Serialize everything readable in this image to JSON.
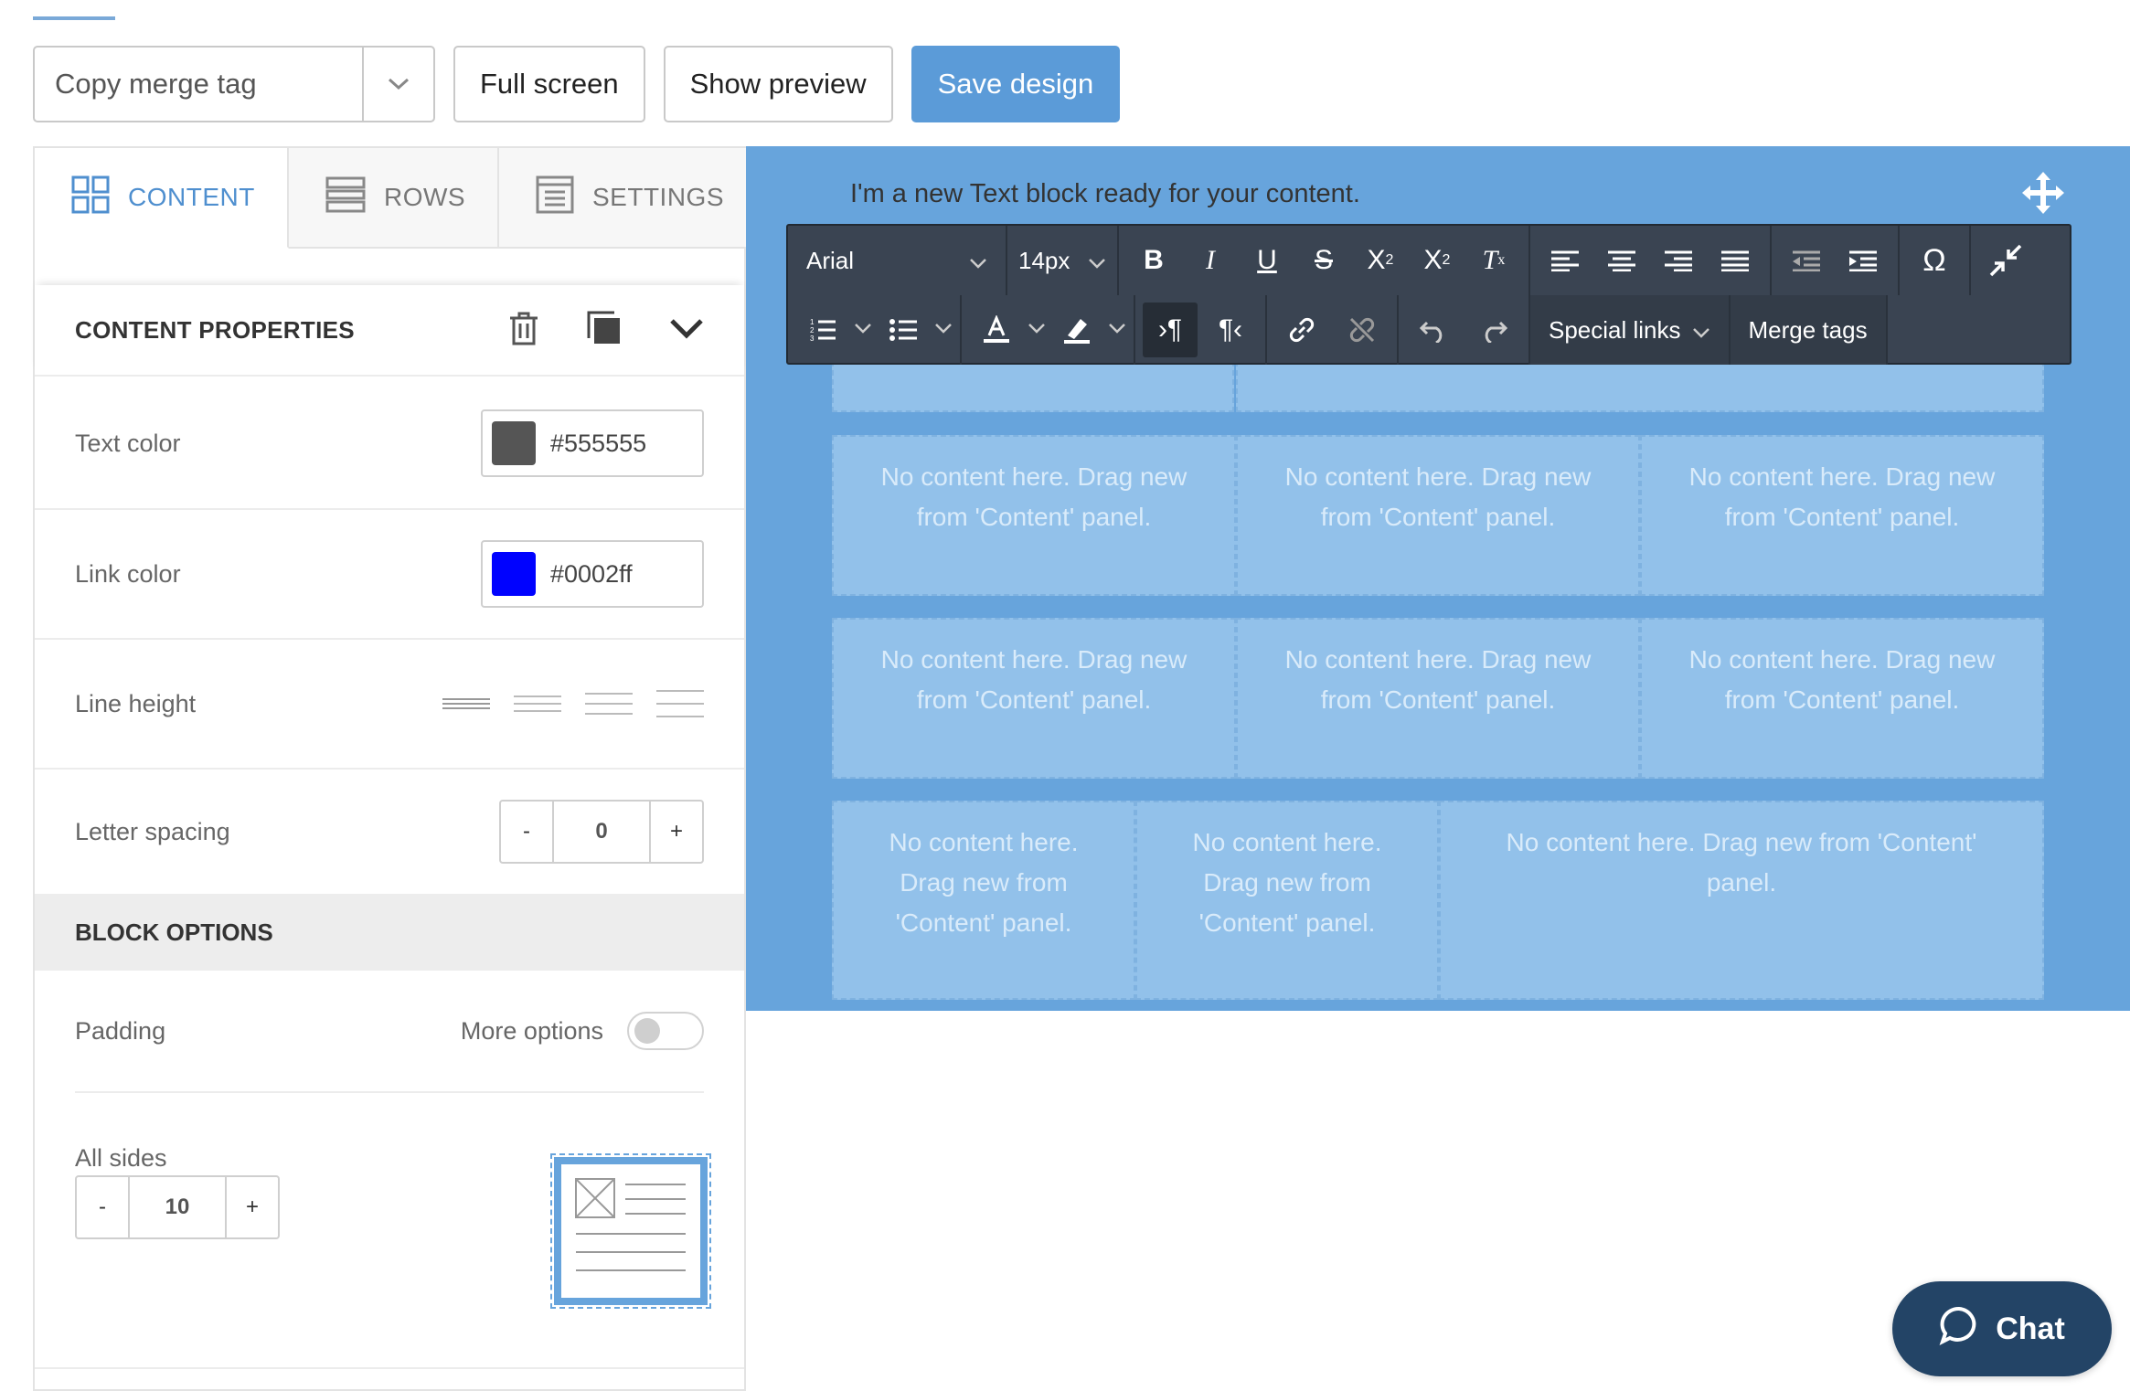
{
  "toolbar": {
    "merge_select": "Copy merge tag",
    "full_screen": "Full screen",
    "show_preview": "Show preview",
    "save_design": "Save design"
  },
  "tabs": [
    {
      "label": "CONTENT",
      "icon": "grid-icon",
      "active": true
    },
    {
      "label": "ROWS",
      "icon": "rows-icon",
      "active": false
    },
    {
      "label": "SETTINGS",
      "icon": "settings-icon",
      "active": false
    }
  ],
  "content_properties": {
    "title": "CONTENT PROPERTIES",
    "text_color": {
      "label": "Text color",
      "value": "#555555",
      "swatch": "#555555"
    },
    "link_color": {
      "label": "Link color",
      "value": "#0002ff",
      "swatch": "#0002ff"
    },
    "line_height": {
      "label": "Line height"
    },
    "letter_spacing": {
      "label": "Letter spacing",
      "minus": "-",
      "value": "0",
      "plus": "+"
    }
  },
  "block_options": {
    "title": "BLOCK OPTIONS",
    "padding": {
      "label": "Padding",
      "more_options": "More options"
    },
    "all_sides": {
      "label": "All sides",
      "minus": "-",
      "value": "10",
      "plus": "+"
    }
  },
  "canvas": {
    "text_block": "I'm a new Text block ready for your content.",
    "empty_cell": "No content here. Drag new from 'Content' panel.",
    "bg_color": "#67a4dc"
  },
  "editor": {
    "font": "Arial",
    "size": "14px",
    "special_links": "Special links",
    "merge_tags": "Merge tags"
  },
  "chat": {
    "label": "Chat"
  }
}
